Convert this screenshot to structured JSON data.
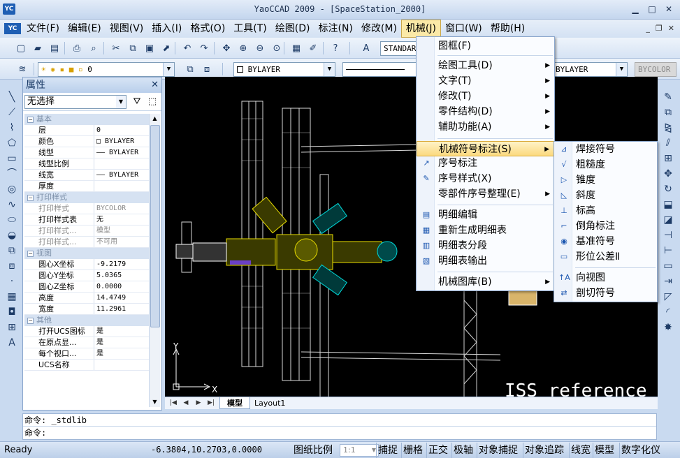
{
  "window": {
    "app_logo": "YC",
    "title": "YaoCCAD 2009 - [SpaceStation_2000]",
    "minimize": "▁",
    "maximize": "□",
    "close": "✕"
  },
  "menubar": {
    "logo": "YC",
    "items": [
      "文件(F)",
      "编辑(E)",
      "视图(V)",
      "插入(I)",
      "格式(O)",
      "工具(T)",
      "绘图(D)",
      "标注(N)",
      "修改(M)",
      "机械(J)",
      "窗口(W)",
      "帮助(H)"
    ],
    "active_index": 9,
    "mdi": {
      "min": "_",
      "restore": "❐",
      "close": "✕"
    }
  },
  "toolbar1": {
    "text_style": "STANDARD",
    "icons": [
      "new-file-icon",
      "open-file-icon",
      "save-icon",
      "print-icon",
      "print-preview-icon",
      "cut-icon",
      "copy-icon",
      "paste-icon",
      "match-properties-icon",
      "undo-icon",
      "redo-icon",
      "pan-icon",
      "zoom-realtime-icon",
      "zoom-window-icon",
      "zoom-previous-icon",
      "properties-icon",
      "erase-icon",
      "help-icon",
      "text-style-icon"
    ]
  },
  "toolbar2": {
    "layer": "0",
    "color": "BYLAYER",
    "linetype": "BYLAYER",
    "plotstyle": "BYCOLOR"
  },
  "properties_panel": {
    "title": "属性",
    "selection": "无选择",
    "groups": [
      {
        "name": "基本",
        "rows": [
          {
            "key": "层",
            "value": "0",
            "dim": false
          },
          {
            "key": "颜色",
            "value": "□ BYLAYER",
            "dim": false
          },
          {
            "key": "线型",
            "value": "—— BYLAYER",
            "dim": false
          },
          {
            "key": "线型比例",
            "value": "",
            "dim": false
          },
          {
            "key": "线宽",
            "value": "—— BYLAYER",
            "dim": false
          },
          {
            "key": "厚度",
            "value": "",
            "dim": false
          }
        ]
      },
      {
        "name": "打印样式",
        "rows": [
          {
            "key": "打印样式",
            "value": "BYCOLOR",
            "dim": true
          },
          {
            "key": "打印样式表",
            "value": "无",
            "dim": false
          },
          {
            "key": "打印样式...",
            "value": "模型",
            "dim": true
          },
          {
            "key": "打印样式...",
            "value": "不可用",
            "dim": true
          }
        ]
      },
      {
        "name": "视图",
        "rows": [
          {
            "key": "圆心X坐标",
            "value": "-9.2179",
            "dim": false
          },
          {
            "key": "圆心Y坐标",
            "value": "5.0365",
            "dim": false
          },
          {
            "key": "圆心Z坐标",
            "value": "0.0000",
            "dim": false
          },
          {
            "key": "高度",
            "value": "14.4749",
            "dim": false
          },
          {
            "key": "宽度",
            "value": "11.2961",
            "dim": false
          }
        ]
      },
      {
        "name": "其他",
        "rows": [
          {
            "key": "打开UCS图标",
            "value": "是",
            "dim": false
          },
          {
            "key": "在原点显...",
            "value": "是",
            "dim": false
          },
          {
            "key": "每个视口...",
            "value": "是",
            "dim": false
          },
          {
            "key": "UCS名称",
            "value": "",
            "dim": false
          }
        ]
      }
    ]
  },
  "canvas": {
    "watermark": "ISS reference",
    "axis_x": "X",
    "axis_y": "Y"
  },
  "view_tabs": {
    "nav": [
      "|◀",
      "◀",
      "▶",
      "▶|"
    ],
    "tabs": [
      "模型",
      "Layout1"
    ]
  },
  "command_line": {
    "line1": "命令:  _stdlib",
    "line2": "命令:"
  },
  "statusbar": {
    "ready": "Ready",
    "coords": "-6.3804,10.2703,0.0000",
    "scale_label": "图纸比例",
    "scale_value": "1:1",
    "toggles": [
      "捕捉",
      "栅格",
      "正交",
      "极轴",
      "对象捕捉",
      "对象追踪",
      "线宽",
      "模型",
      "数字化仪"
    ]
  },
  "mech_menu": {
    "items": [
      {
        "label": "图框(F)",
        "icon": "",
        "submenu": false
      },
      {
        "label": "绘图工具(D)",
        "icon": "",
        "submenu": true
      },
      {
        "label": "文字(T)",
        "icon": "",
        "submenu": true
      },
      {
        "label": "修改(T)",
        "icon": "",
        "submenu": true
      },
      {
        "label": "零件结构(D)",
        "icon": "",
        "submenu": true
      },
      {
        "label": "辅助功能(A)",
        "icon": "",
        "submenu": true
      },
      {
        "label": "机械符号标注(S)",
        "icon": "",
        "submenu": true
      },
      {
        "label": "序号标注",
        "icon": "↗",
        "submenu": false
      },
      {
        "label": "序号样式(X)",
        "icon": "✎",
        "submenu": false
      },
      {
        "label": "零部件序号整理(E)",
        "icon": "",
        "submenu": true
      },
      {
        "label": "明细编辑",
        "icon": "▤",
        "submenu": false
      },
      {
        "label": "重新生成明细表",
        "icon": "▦",
        "submenu": false
      },
      {
        "label": "明细表分段",
        "icon": "▥",
        "submenu": false
      },
      {
        "label": "明细表输出",
        "icon": "▧",
        "submenu": false
      },
      {
        "label": "机械图库(B)",
        "icon": "",
        "submenu": true
      }
    ],
    "highlighted_index": 6
  },
  "symbol_submenu": {
    "items": [
      {
        "label": "焊接符号",
        "icon": "⊿"
      },
      {
        "label": "粗糙度",
        "icon": "√"
      },
      {
        "label": "锥度",
        "icon": "▷"
      },
      {
        "label": "斜度",
        "icon": "◺"
      },
      {
        "label": "标高",
        "icon": "⊥"
      },
      {
        "label": "倒角标注",
        "icon": "⌐"
      },
      {
        "label": "基准符号",
        "icon": "◉"
      },
      {
        "label": "形位公差Ⅱ",
        "icon": "▭"
      },
      {
        "label": "向视图",
        "icon": "↑A"
      },
      {
        "label": "剖切符号",
        "icon": "⇄"
      }
    ]
  }
}
